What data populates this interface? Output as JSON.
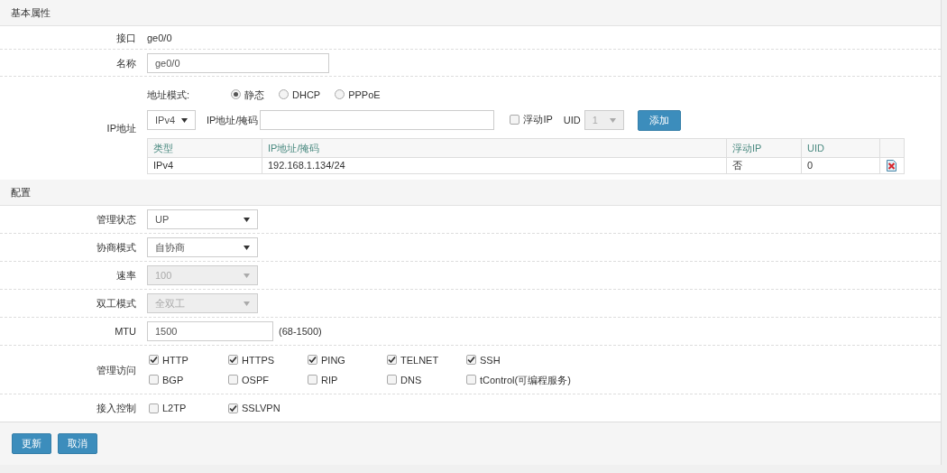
{
  "sections": [
    {
      "title": "基本属性",
      "rows": [
        {
          "kind": "text",
          "label": "接口",
          "value": "ge0/0"
        },
        {
          "kind": "input",
          "label": "名称",
          "value": "ge0/0"
        },
        {
          "kind": "ip",
          "label": "IP地址",
          "mode_label": "地址模式:",
          "modes": [
            {
              "label": "静态",
              "selected": true
            },
            {
              "label": "DHCP",
              "selected": false
            },
            {
              "label": "PPPoE",
              "selected": false
            }
          ],
          "family": "IPv4",
          "mask_label": "IP地址/掩码",
          "floating": {
            "label": "浮动IP",
            "checked": false
          },
          "uid_label": "UID",
          "uid": {
            "value": "1",
            "disabled": true
          },
          "add_button": "添加",
          "columns": [
            "类型",
            "IP地址/掩码",
            "浮动IP",
            "UID"
          ],
          "table_rows": [
            [
              "IPv4",
              "192.168.1.134/24",
              "否",
              "0"
            ]
          ]
        }
      ]
    },
    {
      "title": "配置",
      "rows": [
        {
          "kind": "select",
          "label": "管理状态",
          "value": "UP",
          "disabled": false
        },
        {
          "kind": "select",
          "label": "协商模式",
          "value": "自协商",
          "disabled": false
        },
        {
          "kind": "select",
          "label": "速率",
          "value": "100",
          "disabled": true
        },
        {
          "kind": "select",
          "label": "双工模式",
          "value": "全双工",
          "disabled": true
        },
        {
          "kind": "input",
          "label": "MTU",
          "value": "1500",
          "hint": "(68-1500)"
        },
        {
          "kind": "checks",
          "label": "管理访问",
          "options": [
            {
              "label": "HTTP",
              "checked": true
            },
            {
              "label": "HTTPS",
              "checked": true
            },
            {
              "label": "PING",
              "checked": true
            },
            {
              "label": "TELNET",
              "checked": true
            },
            {
              "label": "SSH",
              "checked": true
            },
            {
              "label": "BGP",
              "checked": false
            },
            {
              "label": "OSPF",
              "checked": false
            },
            {
              "label": "RIP",
              "checked": false
            },
            {
              "label": "DNS",
              "checked": false
            },
            {
              "label": "tControl(可编程服务)",
              "checked": false
            }
          ]
        },
        {
          "kind": "checks",
          "label": "接入控制",
          "options": [
            {
              "label": "L2TP",
              "checked": false
            },
            {
              "label": "SSLVPN",
              "checked": true
            }
          ]
        }
      ]
    }
  ],
  "buttons": [
    "更新",
    "取消"
  ]
}
